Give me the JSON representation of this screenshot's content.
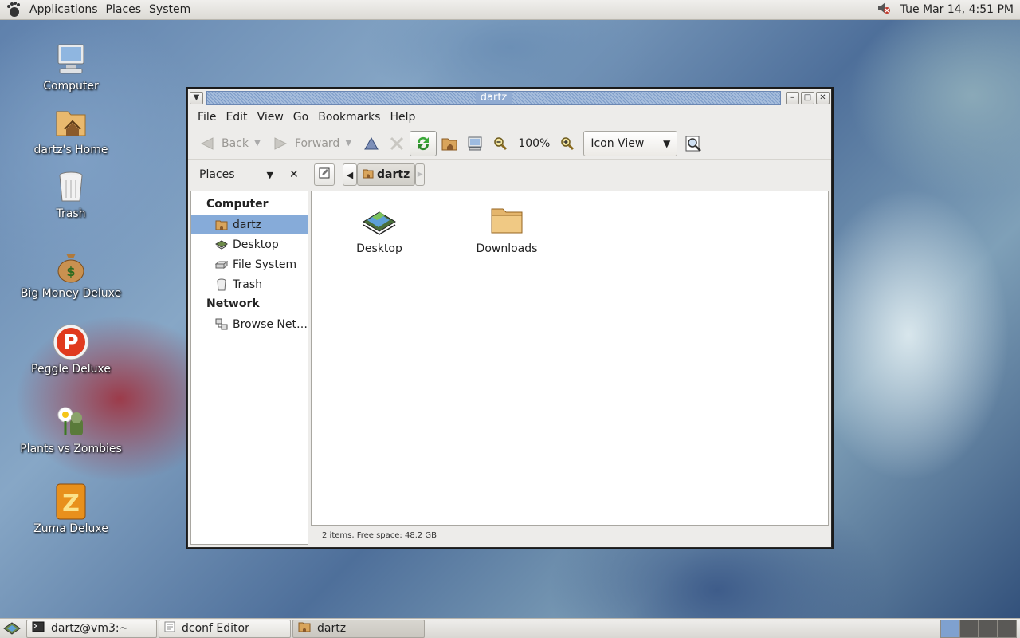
{
  "top_panel": {
    "menus": [
      "Applications",
      "Places",
      "System"
    ],
    "clock": "Tue Mar 14,  4:51 PM"
  },
  "desktop_icons": [
    {
      "label": "Computer",
      "icon": "computer-icon"
    },
    {
      "label": "dartz's Home",
      "icon": "home-folder-icon"
    },
    {
      "label": "Trash",
      "icon": "trash-icon"
    },
    {
      "label": "Big Money Deluxe",
      "icon": "money-bag-icon"
    },
    {
      "label": "Peggle Deluxe",
      "icon": "peggle-icon"
    },
    {
      "label": "Plants vs Zombies",
      "icon": "plants-vs-zombies-icon"
    },
    {
      "label": "Zuma Deluxe",
      "icon": "zuma-icon"
    }
  ],
  "window": {
    "title": "dartz",
    "menubar": [
      "File",
      "Edit",
      "View",
      "Go",
      "Bookmarks",
      "Help"
    ],
    "toolbar": {
      "back": "Back",
      "forward": "Forward",
      "zoom": "100%",
      "view_mode": "Icon View"
    },
    "sidebar": {
      "header": "Places",
      "categories": [
        {
          "label": "Computer",
          "items": [
            {
              "label": "dartz",
              "icon": "home-icon",
              "selected": true
            },
            {
              "label": "Desktop",
              "icon": "desktop-icon",
              "selected": false
            },
            {
              "label": "File System",
              "icon": "drive-icon",
              "selected": false
            },
            {
              "label": "Trash",
              "icon": "trash-icon",
              "selected": false
            }
          ]
        },
        {
          "label": "Network",
          "items": [
            {
              "label": "Browse Net…",
              "icon": "network-icon",
              "selected": false
            }
          ]
        }
      ]
    },
    "breadcrumb": "dartz",
    "files": [
      {
        "name": "Desktop",
        "icon": "desktop-folder-icon"
      },
      {
        "name": "Downloads",
        "icon": "folder-icon"
      }
    ],
    "status": "2 items, Free space: 48.2 GB"
  },
  "taskbar": {
    "tasks": [
      {
        "label": "dartz@vm3:~",
        "icon": "terminal-icon",
        "active": false
      },
      {
        "label": "dconf Editor",
        "icon": "dconf-icon",
        "active": false
      },
      {
        "label": "dartz",
        "icon": "home-icon",
        "active": true
      }
    ]
  },
  "colors": {
    "selection": "#86abd9",
    "title_bar": "#90abd2",
    "panel": "#dcdad5"
  }
}
